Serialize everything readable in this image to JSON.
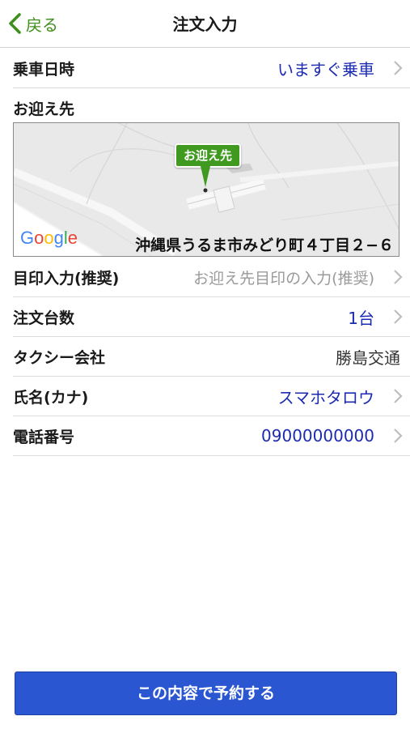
{
  "nav": {
    "back_label": "戻る",
    "title": "注文入力"
  },
  "rows": {
    "ride_time": {
      "label": "乗車日時",
      "value": "いますぐ乗車"
    },
    "pickup": {
      "label": "お迎え先"
    },
    "landmark": {
      "label": "目印入力(推奨)",
      "placeholder": "お迎え先目印の入力(推奨)"
    },
    "count": {
      "label": "注文台数",
      "value": "1台"
    },
    "company": {
      "label": "タクシー会社",
      "value": "勝島交通"
    },
    "name": {
      "label": "氏名(カナ)",
      "value": "スマホタロウ"
    },
    "phone": {
      "label": "電話番号",
      "value": "09000000000"
    }
  },
  "map": {
    "pin_label": "お迎え先",
    "address": "沖縄県うるま市みどり町４丁目２−６",
    "attribution": [
      "G",
      "o",
      "o",
      "g",
      "l",
      "e"
    ]
  },
  "submit_label": "この内容で予約する",
  "colors": {
    "accent_green": "#3f8f1c",
    "value_blue": "#1c2bb0",
    "button_blue": "#2a56d2"
  }
}
